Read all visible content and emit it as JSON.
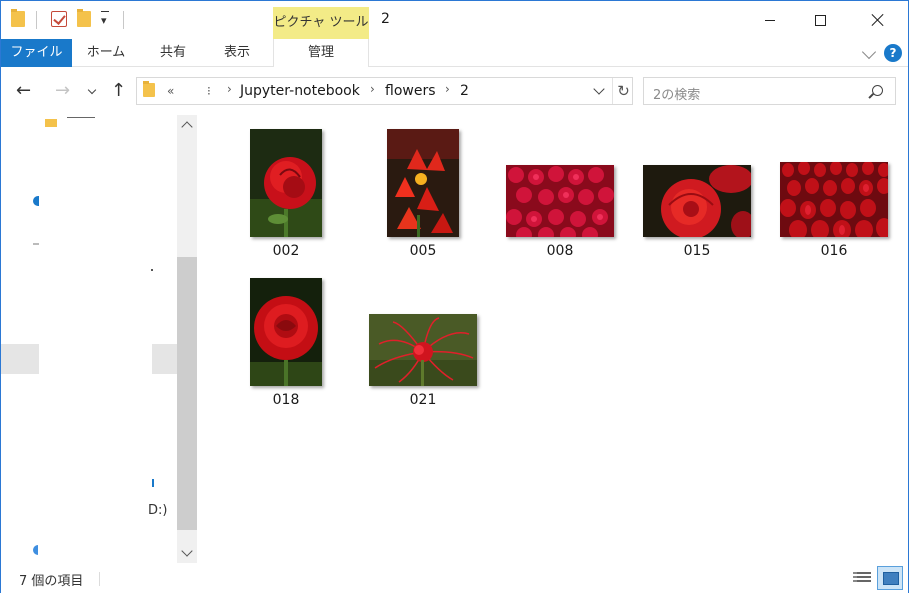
{
  "window": {
    "title": "2",
    "contextual_tab_header": "ピクチャ ツール"
  },
  "ribbon": {
    "tabs": [
      {
        "label": "ファイル"
      },
      {
        "label": "ホーム"
      },
      {
        "label": "共有"
      },
      {
        "label": "表示"
      },
      {
        "label": "管理"
      }
    ],
    "help": "?"
  },
  "address": {
    "overflow": "«",
    "more": "⁝",
    "path": [
      "Jupyter-notebook",
      "flowers",
      "2"
    ],
    "separator": "›"
  },
  "search": {
    "placeholder": "2の検索"
  },
  "navpane": {
    "fragment_drive": "D:)"
  },
  "files": [
    {
      "name": "002",
      "image": "rose-closeup"
    },
    {
      "name": "005",
      "image": "red-tulips"
    },
    {
      "name": "008",
      "image": "rose-field"
    },
    {
      "name": "015",
      "image": "rose-bloom"
    },
    {
      "name": "016",
      "image": "tulip-field"
    },
    {
      "name": "018",
      "image": "red-rose"
    },
    {
      "name": "021",
      "image": "spider-lily"
    }
  ],
  "status": {
    "item_count": "7 個の項目"
  },
  "colors": {
    "accent": "#1979ca",
    "contextual_tab": "#f3eb87",
    "selection": "#cce4f7"
  }
}
